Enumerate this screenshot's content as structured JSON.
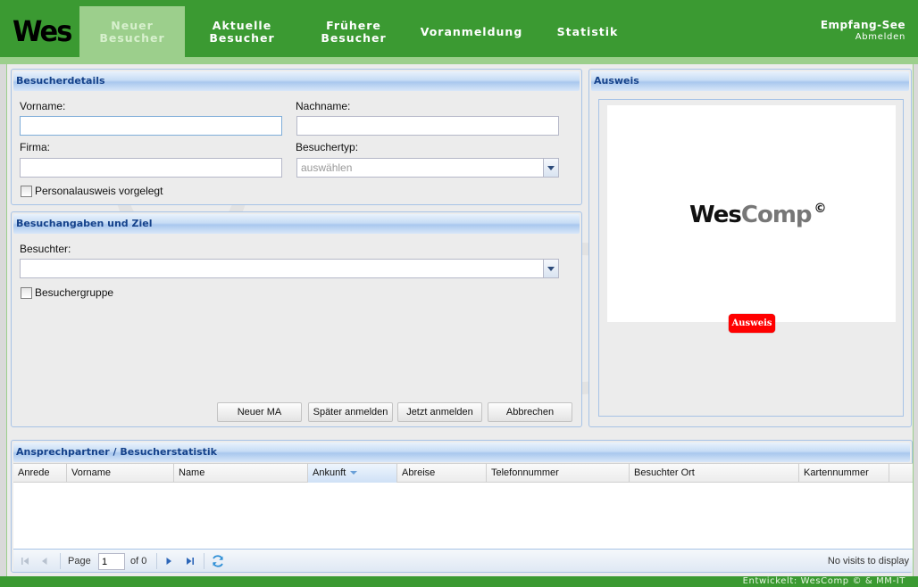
{
  "app": {
    "logo": "Wes",
    "user": "Empfang-See",
    "logout": "Abmelden"
  },
  "nav": {
    "new_visitor": [
      "Neuer",
      "Besucher"
    ],
    "current": [
      "Aktuelle",
      "Besucher"
    ],
    "past": [
      "Frühere",
      "Besucher"
    ],
    "preregistration": "Voranmeldung",
    "statistics": "Statistik"
  },
  "details": {
    "title": "Besucherdetails",
    "first_name_label": "Vorname:",
    "first_name_value": "",
    "last_name_label": "Nachname:",
    "last_name_value": "",
    "company_label": "Firma:",
    "company_value": "",
    "type_label": "Besuchertyp:",
    "type_placeholder": "auswählen",
    "id_checkbox_label": "Personalausweis vorgelegt"
  },
  "visit": {
    "title": "Besuchangaben und Ziel",
    "visited_label": "Besuchter:",
    "visited_value": "",
    "group_checkbox_label": "Besuchergruppe",
    "buttons": {
      "new_employee": "Neuer MA",
      "register_later": "Später anmelden",
      "register_now": "Jetzt anmelden",
      "cancel": "Abbrechen"
    }
  },
  "badge": {
    "title": "Ausweis",
    "logo_wes": "Wes",
    "logo_comp": "Comp",
    "logo_copyright": "©",
    "button": "Ausweis"
  },
  "grid": {
    "title": "Ansprechpartner / Besucherstatistik",
    "columns": [
      "Anrede",
      "Vorname",
      "Name",
      "Ankunft",
      "Abreise",
      "Telefonnummer",
      "Besuchter Ort",
      "Kartennummer"
    ],
    "sorted_column": "Ankunft",
    "rows": [],
    "pager": {
      "page_label": "Page",
      "page_value": "1",
      "of_label": "of 0",
      "empty_text": "No visits to display"
    }
  },
  "footer": {
    "credit": "Entwickelt: WesComp © & MM-IT"
  },
  "colors": {
    "brand_green": "#3b9a32",
    "active_tab": "#9ccf8c",
    "panel_title": "#15428b",
    "badge_red": "#ff0000"
  }
}
